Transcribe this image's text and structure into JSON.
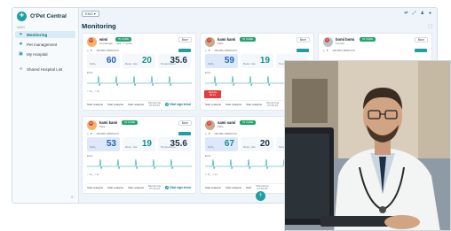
{
  "app": {
    "brand": "O'Pet Central"
  },
  "sidebar": {
    "menu_head": "MAIN",
    "items": [
      {
        "label": "Monitoring",
        "icon": "heart-monitor-icon",
        "active": true
      },
      {
        "label": "Pet management",
        "icon": "paw-icon",
        "active": false
      },
      {
        "label": "My Hospital",
        "icon": "hospital-icon",
        "active": false
      },
      {
        "label": "Shared Hospital List",
        "icon": "share-icon",
        "active": false
      }
    ],
    "collapse": "«"
  },
  "topbar": {
    "ward_select": "ENG ▾",
    "icons": [
      "language-icon",
      "fullscreen-icon",
      "notification-icon",
      "user-icon"
    ]
  },
  "page": {
    "title": "Monitoring"
  },
  "cards": [
    {
      "name": "wimi",
      "tag": "IN CARE",
      "sub": "Leonberger · male · 7 years",
      "more": "More",
      "serial": "MR4B1C0B2D2C9",
      "spo2": "60",
      "spo2_label": "SpO₂",
      "hr": "20",
      "hr_label": "Resp. rate",
      "temp": "35.6",
      "temp_label": "Temperature",
      "badge": "10",
      "ecg_label": "ECG",
      "axis": "< 1x_  > 1x",
      "foot": {
        "start": "Start analysis",
        "stop": "Start analysis",
        "graph": "Start analysis",
        "meta_top": "Monitoring",
        "meta_time": "07:04:24",
        "vital": "Vital sign trend"
      }
    },
    {
      "name": "kami kami",
      "tag": "IN CARE",
      "sub": "Male",
      "more": "More",
      "serial": "MR4B1C0B2D2C9",
      "spo2": "59",
      "spo2_label": "SpO₂",
      "hr": "19",
      "hr_label": "Resp. rate",
      "temp": "",
      "temp_label": "Temperature",
      "badge": "2",
      "ecg_label": "ECG",
      "axis": "< 1x_  > 1x",
      "foot": {
        "start": "Start analysis",
        "stop": "Start analysis",
        "graph": "Start analysis",
        "meta_top": "Monitoring",
        "meta_time": "07:26:19",
        "vital": ""
      }
    },
    {
      "name": "kami kami",
      "tag": "IN CARE",
      "sub": "Male",
      "more": "More",
      "serial": "MR4B1C0B2D2C9",
      "spo2": "53",
      "spo2_label": "SpO₂",
      "hr": "19",
      "hr_label": "Resp. rate",
      "temp": "35.6",
      "temp_label": "Temperature",
      "badge": "10",
      "ecg_label": "ECG",
      "axis": "< 1x_  > 1x",
      "foot": {
        "start": "Start analysis",
        "stop": "Start analysis",
        "graph": "Start analysis",
        "meta_top": "Monitoring",
        "meta_time": "07:23:19",
        "vital": "Vital sign trend"
      }
    },
    {
      "name": "sami sami",
      "tag": "IN CARE",
      "sub": "Male",
      "more": "More",
      "serial": "MR4B1C0B2D2C9",
      "spo2": "67",
      "spo2_label": "SpO₂",
      "hr": "20",
      "hr_label": "Resp. rate",
      "temp": "",
      "temp_label": "Temperature",
      "badge": "2",
      "ecg_label": "ECG",
      "axis": "< 1x_  > 1x",
      "foot": {
        "start": "Start analysis",
        "stop": "Start analysis",
        "graph": "Start",
        "meta_top": "Monitoring",
        "meta_time": "07:43:23",
        "vital": ""
      }
    },
    {
      "name": "bomi bomi",
      "tag": "IN CARE",
      "sub": "Female",
      "more": "More",
      "serial": "MR4B1C0B2D2C9",
      "badge": "3"
    }
  ],
  "alert": {
    "line1": "Seizure",
    "line2": "00:41"
  },
  "fab": "⚕",
  "colors": {
    "accent": "#1e9fa4",
    "alert": "#e23b3b",
    "badge": "#e03b3b",
    "tag": "#23a56b"
  }
}
